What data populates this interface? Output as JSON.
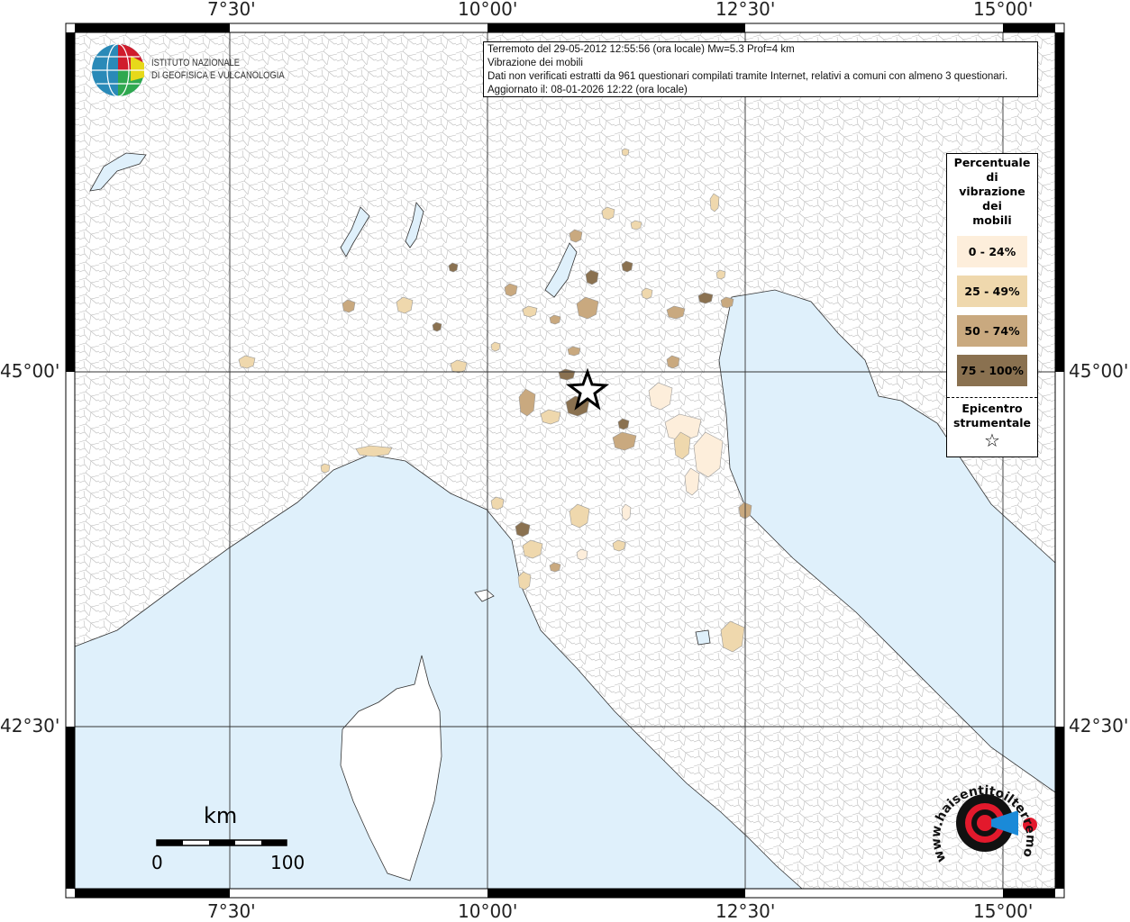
{
  "info": {
    "line1": "Terremoto del 29-05-2012 12:55:56 (ora locale) Mw=5.3 Prof=4 km",
    "line2": "Vibrazione dei mobili",
    "line3": "Dati non verificati estratti da 961 questionari compilati tramite Internet, relativi a comuni con almeno 3 questionari.",
    "line4": "Aggiornato il: 08-01-2026 12:22 (ora locale)"
  },
  "logo": {
    "line1": "ISTITUTO NAZIONALE",
    "line2": "DI GEOFISICA E VULCANOLOGIA"
  },
  "logo2": {
    "text": "www.haisentitoilterremoto.it"
  },
  "legend": {
    "title": [
      "Percentuale",
      "di",
      "vibrazione",
      "dei",
      "mobili"
    ],
    "classes": [
      {
        "label": "0 - 24%",
        "color": "#fdeedb"
      },
      {
        "label": "25 - 49%",
        "color": "#efd8ad"
      },
      {
        "label": "50 - 74%",
        "color": "#c9a97f"
      },
      {
        "label": "75 - 100%",
        "color": "#8a7150"
      }
    ],
    "epicenter_label1": "Epicentro",
    "epicenter_label2": "strumentale",
    "epicenter_symbol": "☆"
  },
  "axes": {
    "lon_ticks": [
      "7°30'",
      "10°00'",
      "12°30'",
      "15°00'"
    ],
    "lat_ticks": [
      "45°00'",
      "42°30'"
    ]
  },
  "scale": {
    "unit": "km",
    "min": "0",
    "max": "100"
  },
  "colors": {
    "sea": "#dff0fb",
    "land": "#ffffff"
  }
}
